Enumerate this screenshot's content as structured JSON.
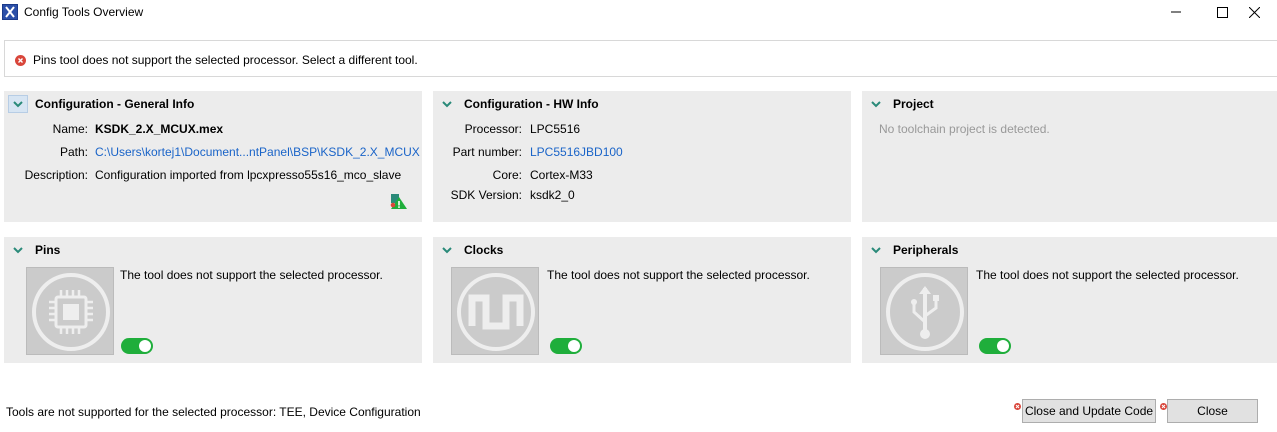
{
  "window": {
    "title": "Config Tools Overview"
  },
  "message": {
    "text": "Pins tool does not support the selected processor. Select a different tool."
  },
  "general": {
    "title": "Configuration - General Info",
    "name_label": "Name:",
    "name": "KSDK_2.X_MCUX.mex",
    "path_label": "Path:",
    "path": "C:\\Users\\kortej1\\Document...ntPanel\\BSP\\KSDK_2.X_MCUX",
    "desc_label": "Description:",
    "desc": "Configuration imported from lpcxpresso55s16_mco_slave"
  },
  "hw": {
    "title": "Configuration - HW Info",
    "processor_label": "Processor:",
    "processor": "LPC5516",
    "part_label": "Part number:",
    "part": "LPC5516JBD100",
    "core_label": "Core:",
    "core": "Cortex-M33",
    "sdk_label": "SDK Version:",
    "sdk": "ksdk2_0"
  },
  "project": {
    "title": "Project",
    "text": "No toolchain project is detected."
  },
  "tools": [
    {
      "title": "Pins",
      "message": "The tool does not support the selected processor.",
      "icon": "chip-icon",
      "enabled": true
    },
    {
      "title": "Clocks",
      "message": "The tool does not support the selected processor.",
      "icon": "clock-wave-icon",
      "enabled": true
    },
    {
      "title": "Peripherals",
      "message": "The tool does not support the selected processor.",
      "icon": "usb-icon",
      "enabled": true
    }
  ],
  "status": {
    "text": "Tools are not supported for the selected processor: TEE, Device Configuration"
  },
  "buttons": {
    "update": "Close and Update Code",
    "close": "Close"
  },
  "colors": {
    "accent": "#1fae3b",
    "link": "#1a64c8",
    "error": "#d9463b",
    "panel": "#ececec"
  }
}
